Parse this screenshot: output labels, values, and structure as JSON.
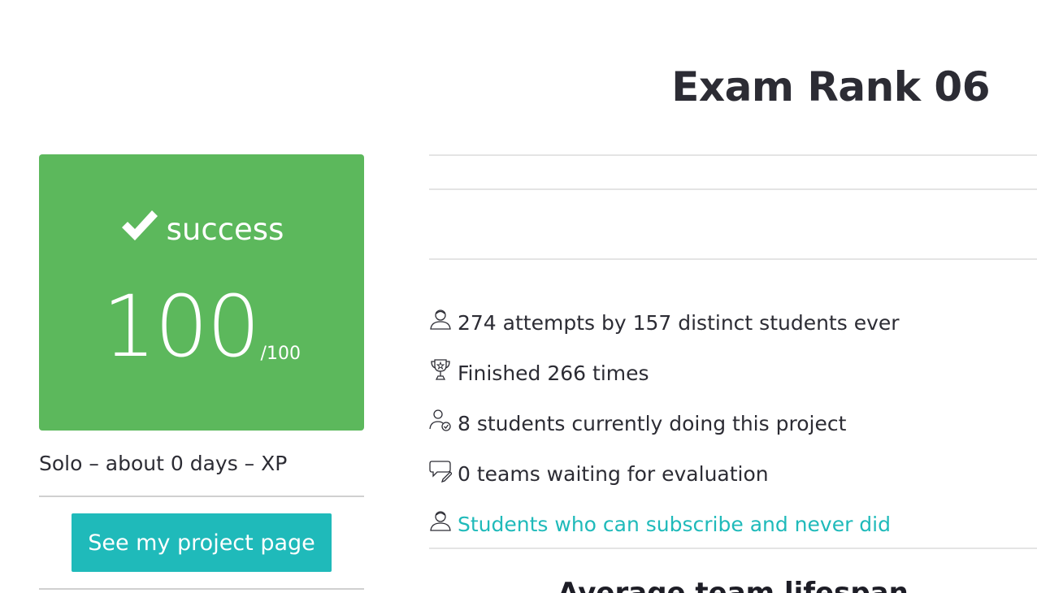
{
  "project": {
    "title": "Exam Rank 06"
  },
  "result": {
    "status": "success",
    "score": "100",
    "max_score": "/100",
    "color": "#5cb85c",
    "icon": "checkmark-icon"
  },
  "meta": {
    "line": "Solo – about 0 days – XP"
  },
  "actions": {
    "project_page_button": "See my project page",
    "accent_color": "#1fbaba"
  },
  "stats": {
    "attempts": {
      "text": "274 attempts by 157 distinct students ever",
      "icon": "user-icon"
    },
    "finished": {
      "text": "Finished 266 times",
      "icon": "trophy-icon"
    },
    "current": {
      "text": "8 students currently doing this project",
      "icon": "user-check-icon"
    },
    "waiting": {
      "text": "0 teams waiting for evaluation",
      "icon": "speech-bubble-pencil-icon"
    },
    "subscribe_link": {
      "text": "Students who can subscribe and never did",
      "icon": "user-icon"
    }
  },
  "section": {
    "heading": "Average team lifespan"
  }
}
